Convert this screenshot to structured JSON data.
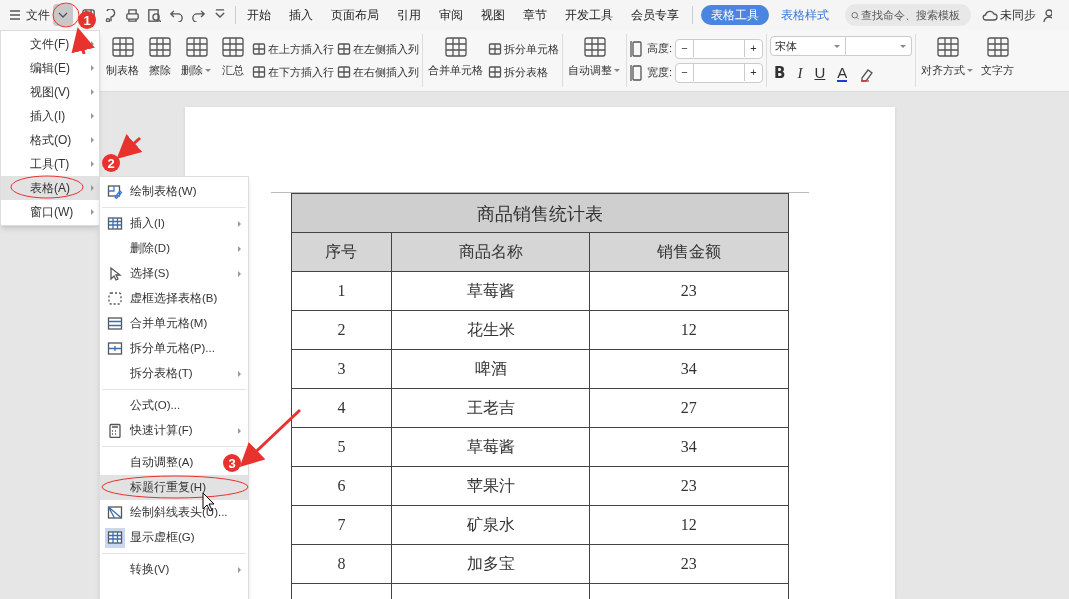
{
  "app_menu": {
    "label": "文件"
  },
  "tabs": [
    {
      "label": "开始",
      "selected": false,
      "kind": "normal"
    },
    {
      "label": "插入",
      "selected": false,
      "kind": "normal"
    },
    {
      "label": "页面布局",
      "selected": false,
      "kind": "normal"
    },
    {
      "label": "引用",
      "selected": false,
      "kind": "normal"
    },
    {
      "label": "审阅",
      "selected": false,
      "kind": "normal"
    },
    {
      "label": "视图",
      "selected": false,
      "kind": "normal"
    },
    {
      "label": "章节",
      "selected": false,
      "kind": "normal"
    },
    {
      "label": "开发工具",
      "selected": false,
      "kind": "normal"
    },
    {
      "label": "会员专享",
      "selected": false,
      "kind": "normal"
    },
    {
      "label": "表格工具",
      "selected": true,
      "kind": "context"
    },
    {
      "label": "表格样式",
      "selected": false,
      "kind": "context"
    }
  ],
  "search": {
    "placeholder": "查找命令、搜索模板"
  },
  "sync_status": "未同步",
  "ribbon_groups": [
    {
      "items": [
        {
          "kind": "large",
          "label": "制表格",
          "dropdown": false
        },
        {
          "kind": "large",
          "label": "擦除",
          "dropdown": false
        },
        {
          "kind": "large",
          "label": "删除",
          "dropdown": true
        },
        {
          "kind": "large",
          "label": "汇总",
          "dropdown": false
        },
        {
          "kind": "pair",
          "labels": [
            "在上方插入行",
            "在下方插入行"
          ]
        },
        {
          "kind": "pair",
          "labels": [
            "在左侧插入列",
            "在右侧插入列"
          ]
        }
      ]
    },
    {
      "items": [
        {
          "kind": "large",
          "label": "合并单元格",
          "dropdown": false
        },
        {
          "kind": "pair",
          "labels": [
            "拆分单元格",
            "拆分表格"
          ]
        }
      ]
    },
    {
      "items": [
        {
          "kind": "large",
          "label": "自动调整",
          "dropdown": true
        }
      ]
    },
    {
      "items": [
        {
          "kind": "spinners",
          "labels": [
            "高度:",
            "宽度:"
          ],
          "minus": "−",
          "plus": "+"
        }
      ]
    },
    {
      "items": [
        {
          "kind": "font",
          "font": "宋体",
          "buttons": [
            "B",
            "I",
            "U",
            "A"
          ]
        }
      ]
    },
    {
      "items": [
        {
          "kind": "large",
          "label": "对齐方式",
          "dropdown": true
        },
        {
          "kind": "large",
          "label": "文字方",
          "dropdown": false
        }
      ]
    }
  ],
  "main_menu": [
    {
      "label": "文件(F)",
      "selected": false
    },
    {
      "label": "编辑(E)",
      "selected": false
    },
    {
      "label": "视图(V)",
      "selected": false
    },
    {
      "label": "插入(I)",
      "selected": false
    },
    {
      "label": "格式(O)",
      "selected": false
    },
    {
      "label": "工具(T)",
      "selected": false
    },
    {
      "label": "表格(A)",
      "selected": true
    },
    {
      "label": "窗口(W)",
      "selected": false
    }
  ],
  "submenu": [
    {
      "label": "绘制表格(W)",
      "kind": "draw",
      "submenu": false,
      "separator_before": false,
      "selected": false,
      "checked": false
    },
    {
      "label": "插入(I)",
      "kind": "grid",
      "submenu": true,
      "separator_before": true,
      "selected": false,
      "checked": false
    },
    {
      "label": "删除(D)",
      "kind": "plain",
      "submenu": true,
      "separator_before": false,
      "selected": false,
      "checked": false
    },
    {
      "label": "选择(S)",
      "kind": "cursor",
      "submenu": true,
      "separator_before": false,
      "selected": false,
      "checked": false
    },
    {
      "label": "虚框选择表格(B)",
      "kind": "dashed",
      "submenu": false,
      "separator_before": false,
      "selected": false,
      "checked": false
    },
    {
      "label": "合并单元格(M)",
      "kind": "merge",
      "submenu": false,
      "separator_before": false,
      "selected": false,
      "checked": false
    },
    {
      "label": "拆分单元格(P)...",
      "kind": "split",
      "submenu": false,
      "separator_before": false,
      "selected": false,
      "checked": false
    },
    {
      "label": "拆分表格(T)",
      "kind": "plain",
      "submenu": true,
      "separator_before": false,
      "selected": false,
      "checked": false
    },
    {
      "label": "公式(O)...",
      "kind": "plain",
      "submenu": false,
      "separator_before": true,
      "selected": false,
      "checked": false
    },
    {
      "label": "快速计算(F)",
      "kind": "calc",
      "submenu": true,
      "separator_before": false,
      "selected": false,
      "checked": false
    },
    {
      "label": "自动调整(A)",
      "kind": "plain",
      "submenu": false,
      "separator_before": true,
      "selected": false,
      "checked": false
    },
    {
      "label": "标题行重复(H)",
      "kind": "plain",
      "submenu": false,
      "separator_before": false,
      "selected": true,
      "checked": false
    },
    {
      "label": "绘制斜线表头(U)...",
      "kind": "diagonal",
      "submenu": false,
      "separator_before": false,
      "selected": false,
      "checked": false
    },
    {
      "label": "显示虚框(G)",
      "kind": "grid",
      "submenu": false,
      "separator_before": false,
      "selected": false,
      "checked": true
    },
    {
      "label": "转换(V)",
      "kind": "plain",
      "submenu": true,
      "separator_before": true,
      "selected": false,
      "checked": false
    }
  ],
  "document": {
    "table": {
      "title": "商品销售统计表",
      "columns": [
        "序号",
        "商品名称",
        "销售金额"
      ],
      "rows": [
        [
          "1",
          "草莓酱",
          "23"
        ],
        [
          "2",
          "花生米",
          "12"
        ],
        [
          "3",
          "啤酒",
          "34"
        ],
        [
          "4",
          "王老吉",
          "27"
        ],
        [
          "5",
          "草莓酱",
          "34"
        ],
        [
          "6",
          "苹果汁",
          "23"
        ],
        [
          "7",
          "矿泉水",
          "12"
        ],
        [
          "8",
          "加多宝",
          "23"
        ]
      ]
    }
  },
  "annotations": [
    {
      "number": "1"
    },
    {
      "number": "2"
    },
    {
      "number": "3"
    }
  ]
}
